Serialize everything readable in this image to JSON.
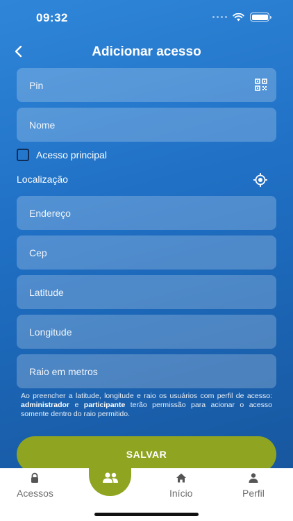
{
  "status_bar": {
    "time": "09:32"
  },
  "header": {
    "title": "Adicionar acesso"
  },
  "form": {
    "pin_placeholder": "Pin",
    "nome_placeholder": "Nome",
    "acesso_principal_label": "Acesso principal",
    "localizacao_label": "Localização",
    "endereco_placeholder": "Endereço",
    "cep_placeholder": "Cep",
    "latitude_placeholder": "Latitude",
    "longitude_placeholder": "Longitude",
    "raio_placeholder": "Raio em metros"
  },
  "note": {
    "part1": "Ao preencher a latitude, longitude e raio os usuários com perfil de acesso: ",
    "admin": "administrador",
    "and": " e ",
    "participant": "participante",
    "part2": " terão permissão para acionar o acesso somente dentro do raio permitido."
  },
  "save_button": {
    "label": "SALVAR"
  },
  "tabbar": {
    "acessos": "Acessos",
    "inicio": "Início",
    "perfil": "Perfil"
  },
  "colors": {
    "accent": "#8fa521",
    "background_top": "#2f86d8",
    "background_bottom": "#17579f"
  }
}
